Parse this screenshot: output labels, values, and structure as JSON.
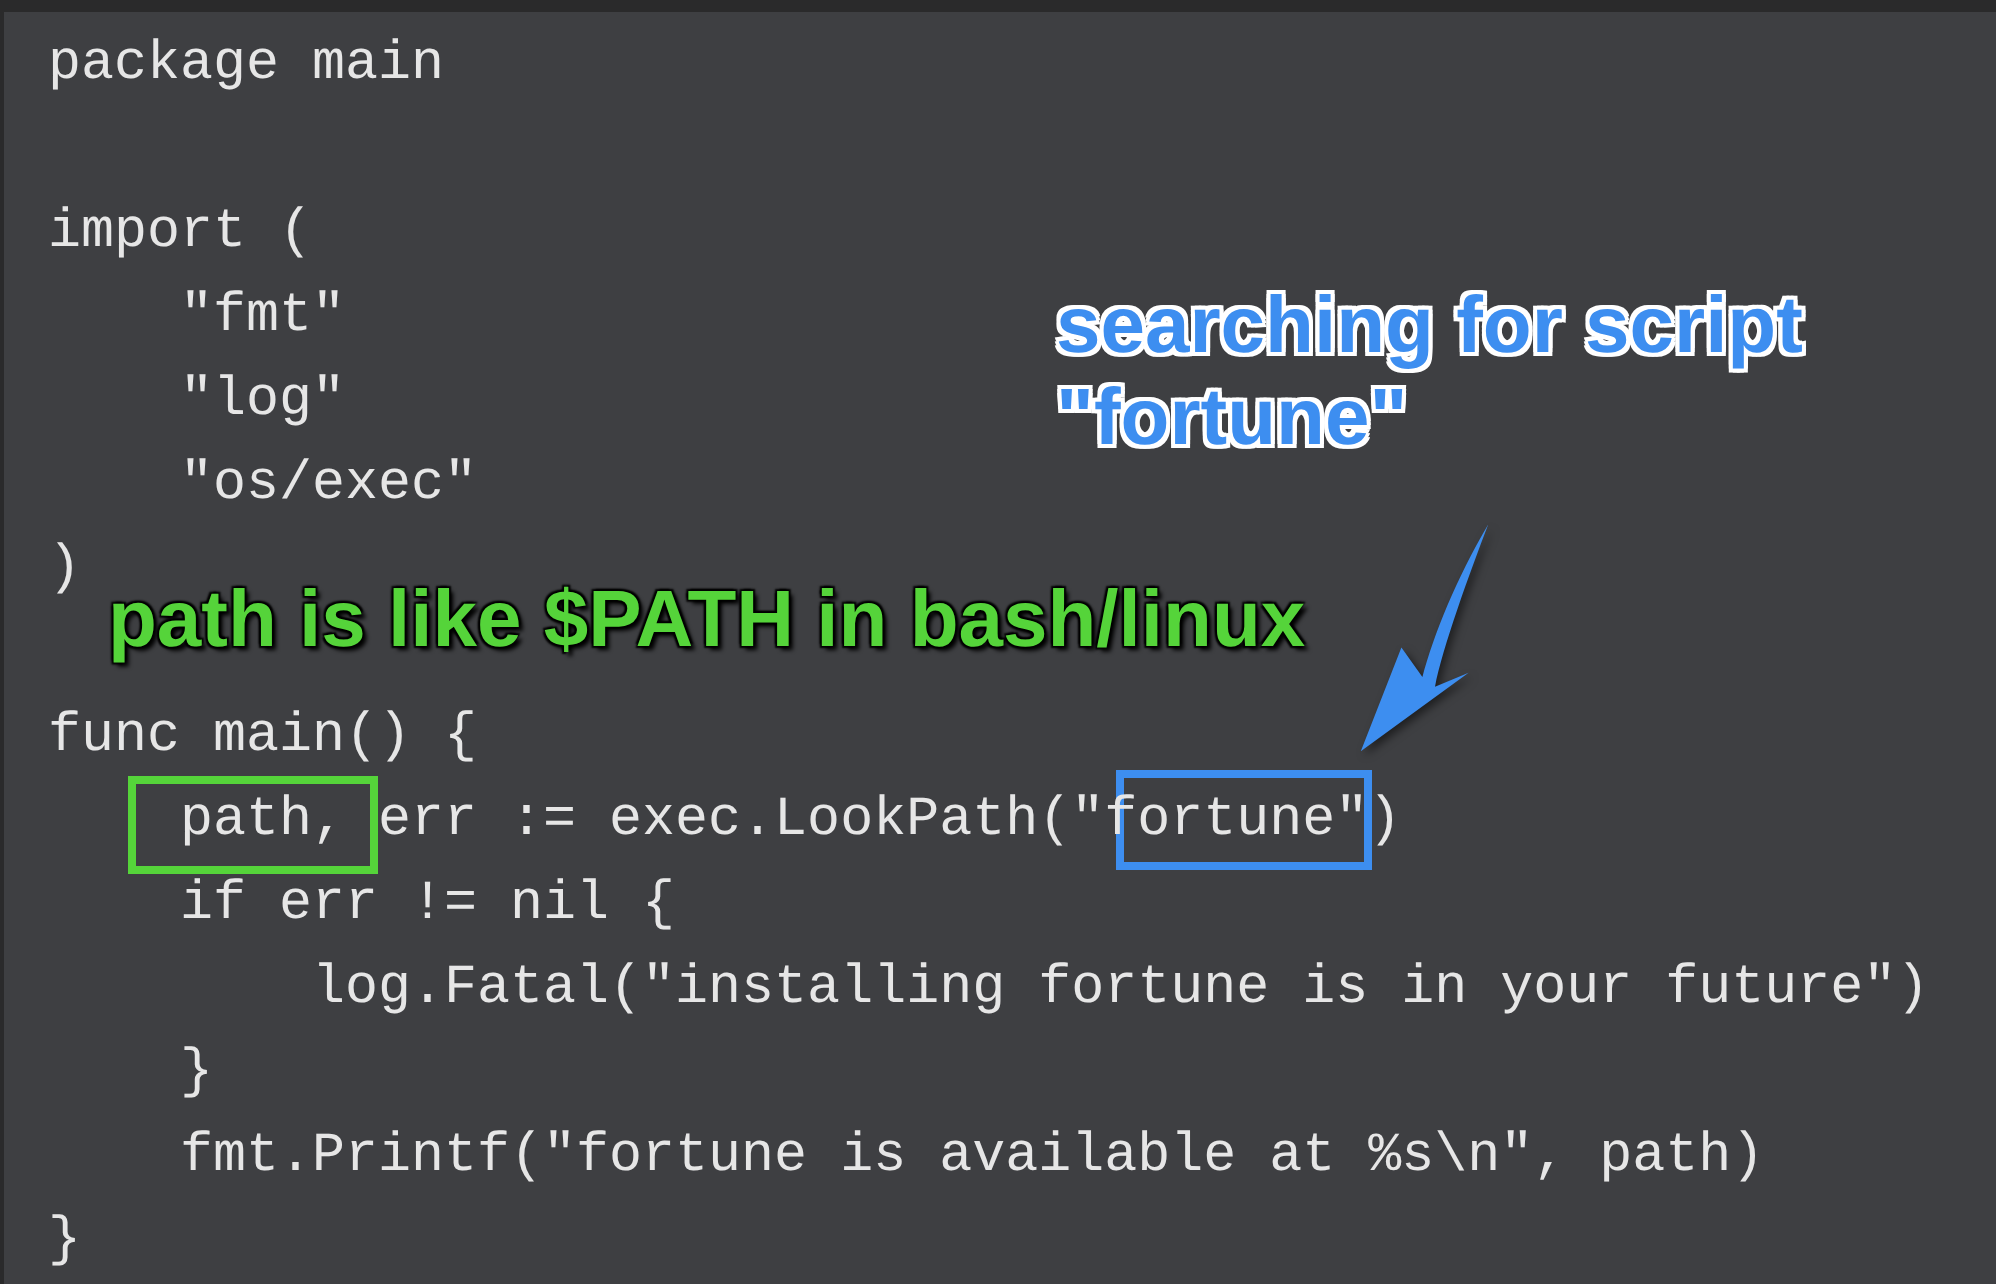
{
  "code_lines": [
    {
      "text": "package main"
    },
    {
      "text": "import (",
      "gap_before": true
    },
    {
      "text": "    \"fmt\""
    },
    {
      "text": "    \"log\""
    },
    {
      "text": "    \"os/exec\""
    },
    {
      "text": ")"
    },
    {
      "text": "func main() {",
      "gap_before": true
    },
    {
      "text": "    path, err := exec.LookPath(\"fortune\")"
    },
    {
      "text": "    if err != nil {"
    },
    {
      "text": "        log.Fatal(\"installing fortune is in your future\")"
    },
    {
      "text": "    }"
    },
    {
      "text": "    fmt.Printf(\"fortune is available at %s\\n\", path)"
    },
    {
      "text": "}"
    }
  ],
  "annotations": [
    {
      "kind": "green",
      "text": "path is like $PATH in bash/linux",
      "color": "#55d43a"
    },
    {
      "kind": "blue",
      "text": "searching for script \"fortune\"",
      "color": "#3d8ef0"
    }
  ],
  "highlights": [
    {
      "kind": "green",
      "color": "#55d43a"
    },
    {
      "kind": "blue",
      "color": "#3d8ef0"
    }
  ]
}
